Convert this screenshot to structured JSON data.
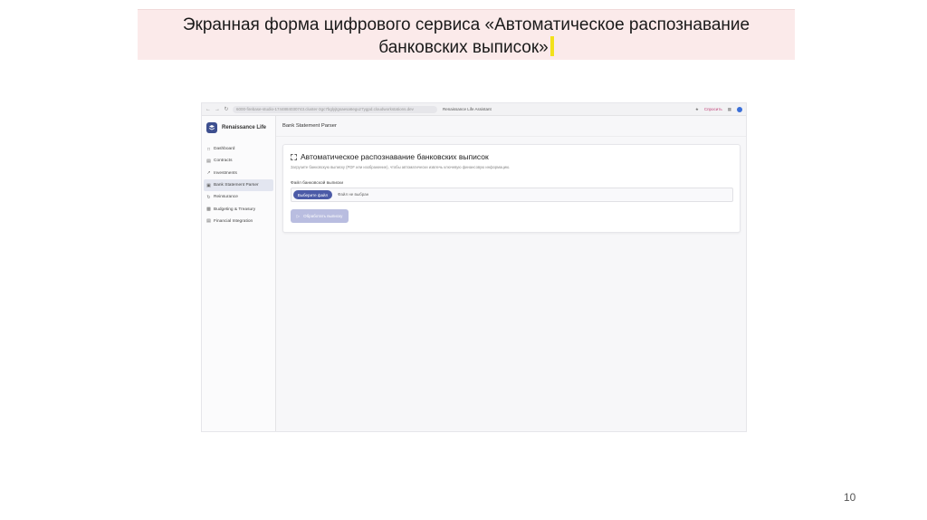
{
  "slide": {
    "title_line1": "Экранная форма цифрового сервиса «Автоматическое распознавание",
    "title_line2": "банковских выписок»",
    "page_number": "10"
  },
  "browser": {
    "url": "6000-firebase-studio-1744884030743.cluster-3gc7bglyjtgsaesa6eguz7ygpd.cloudworkstations.dev",
    "tab_title": "Renaissance Life Assistant",
    "share_label": "Спросить"
  },
  "sidebar": {
    "brand": "Renaissance Life",
    "items": [
      {
        "label": "Dashboard",
        "icon": "dashboard-icon"
      },
      {
        "label": "Contracts",
        "icon": "document-icon"
      },
      {
        "label": "Investments",
        "icon": "trend-icon"
      },
      {
        "label": "Bank Statement Parser",
        "icon": "scan-icon"
      },
      {
        "label": "Reinsurance",
        "icon": "refresh-icon"
      },
      {
        "label": "Budgeting & Treasury",
        "icon": "wallet-icon"
      },
      {
        "label": "Financial Integration",
        "icon": "file-icon"
      }
    ]
  },
  "main": {
    "page_title": "Bank Statement Parser",
    "card": {
      "title": "Автоматическое распознавание банковских выписок",
      "subtitle": "Загрузите банковскую выписку (PDF или изображение), чтобы автоматически извлечь ключевую финансовую информацию.",
      "field_label": "Файл банковской выписки",
      "choose_button": "Выберите файл",
      "no_file_text": "Файл не выбран",
      "process_button": "Обработать выписку"
    }
  },
  "colors": {
    "title_band": "#fbeaea",
    "primary_button": "#4b5aa7",
    "disabled_button": "#b9bde0",
    "brand_logo": "#3d4f8f"
  }
}
